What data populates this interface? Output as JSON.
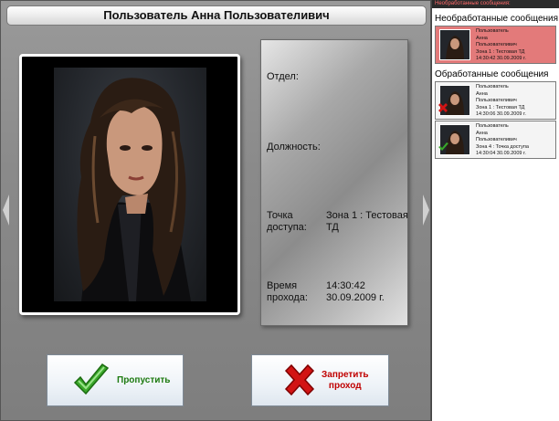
{
  "window": {
    "title": "Пользователь Анна Пользователивич"
  },
  "info": {
    "department_label": "Отдел:",
    "department_value": "",
    "position_label": "Должность:",
    "position_value": "",
    "access_point_label_1": "Точка",
    "access_point_label_2": "доступа:",
    "access_point_value": "Зона 1 : Тестовая ТД",
    "time_label_1": "Время",
    "time_label_2": "прохода:",
    "time_value_time": "14:30:42",
    "time_value_date": "30.09.2009 г."
  },
  "buttons": {
    "allow_label": "Пропустить",
    "deny_label_1": "Запретить",
    "deny_label_2": "проход"
  },
  "sidebar": {
    "header": "Необработанные сообщения:",
    "unprocessed_title": "Необработанные сообщения",
    "processed_title": "Обработанные сообщения",
    "unprocessed": [
      {
        "line1": "Пользователь",
        "line2": "Анна",
        "line3": "Пользователивич",
        "line4": "Зона 1 : Тестовая ТД",
        "line5": "14:30:42 30.09.2009 г."
      }
    ],
    "processed": [
      {
        "line1": "Пользователь",
        "line2": "Анна",
        "line3": "Пользователивич",
        "line4": "Зона 1 : Тестовая ТД",
        "line5": "14:30:06 30.09.2009 г.",
        "status": "denied",
        "badge_icon": "red-x-icon"
      },
      {
        "line1": "Пользователь",
        "line2": "Анна",
        "line3": "Пользователивич",
        "line4": "Зона 4 : Точка доступа",
        "line5": "14:30:04 30.09.2009 г.",
        "status": "allowed",
        "badge_icon": "green-check-icon"
      }
    ]
  },
  "colors": {
    "allow": "#1d7a10",
    "deny": "#c00000",
    "unprocessed_card": "#e37a7a"
  }
}
